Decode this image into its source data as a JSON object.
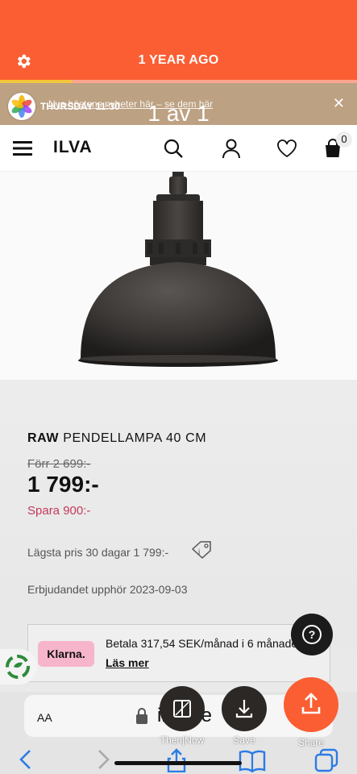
{
  "memories": {
    "title": "1 YEAR AGO",
    "progress_fraction": 0.2,
    "timestamp": "THURSDAY 11:30",
    "gallery_counter": "1 av 1"
  },
  "banner": {
    "promo_text": "Nya höstens nyheter här – se dem här",
    "close": "✕"
  },
  "header": {
    "logo": "ILVA",
    "cart_count": "0"
  },
  "product": {
    "brand": "RAW",
    "name": "PENDELLAMPA 40 CM",
    "old_price": "Förr 2 699:-",
    "price": "1 799:-",
    "savings": "Spara 900:-",
    "lowest_price": "Lägsta pris 30 dagar 1 799:-",
    "offer_ends": "Erbjudandet upphör 2023-09-03"
  },
  "klarna": {
    "logo": "Klarna.",
    "text": "Betala 317,54 SEK/månad i 6 månader",
    "link": "Läs mer"
  },
  "help": {
    "label": "?"
  },
  "browser": {
    "aa": "AA",
    "url_text": "ilva.se"
  },
  "actions": {
    "then_now": "Then|Now",
    "save": "Save",
    "share": "Share"
  },
  "colors": {
    "accent": "#FB5E33",
    "price_save": "#C33A5A",
    "klarna_pink": "#F7B5CC"
  }
}
